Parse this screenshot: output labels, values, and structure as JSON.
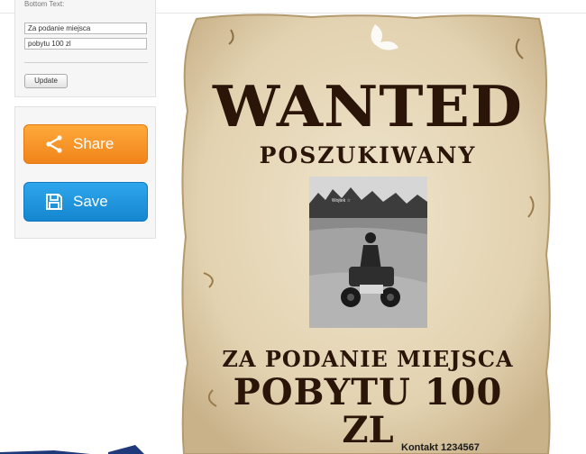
{
  "form": {
    "label": "Bottom Text:",
    "line1": "Za podanie miejsca",
    "line2": "pobytu 100 zl",
    "update_label": "Update"
  },
  "actions": {
    "share_label": "Share",
    "save_label": "Save",
    "share_icon": "share-icon",
    "save_icon": "floppy-disk-icon",
    "share_color": "#f5901f",
    "save_color": "#1e94dc"
  },
  "poster": {
    "title": "WANTED",
    "subtitle": "POSZUKIWANY",
    "bottom_line1": "ZA PODANIE MIEJSCA",
    "bottom_line2": "POBYTU 100",
    "bottom_line3": "ZL",
    "contact": "Kontakt 1234567",
    "photo_caption": "Wojtek ☆",
    "ink_color": "#2b1408",
    "paper_color": "#e9dcc0"
  }
}
